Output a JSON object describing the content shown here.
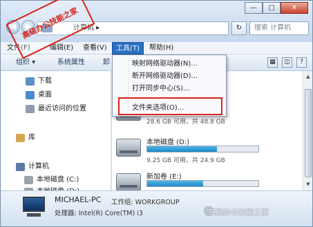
{
  "window": {
    "controls": {
      "minimize": "—",
      "maximize": "□",
      "close": "✕"
    }
  },
  "stamp": {
    "text": "高级办公技能之家"
  },
  "address": {
    "path": "计算机 ▸",
    "refresh": "↻",
    "search_placeholder": "搜索 计算机"
  },
  "menubar": {
    "items": [
      {
        "label": "文件(F)"
      },
      {
        "label": "编辑(E)"
      },
      {
        "label": "查看(V)"
      },
      {
        "label": "工具(T)"
      },
      {
        "label": "帮助(H)"
      }
    ]
  },
  "cmdbar": {
    "organize": "组织 ▾",
    "system_props": "系统属性",
    "cut_label": "卸"
  },
  "navpane": {
    "items": [
      {
        "label": "下载"
      },
      {
        "label": "桌面"
      },
      {
        "label": "最近访问的位置"
      },
      {
        "label": "库"
      },
      {
        "label": "计算机"
      },
      {
        "label": "本地磁盘 (C:)"
      },
      {
        "label": "本地磁盘 (D:)"
      }
    ]
  },
  "drives": [
    {
      "name": "",
      "free": "28.6 GB 可用，共 48.8 GB",
      "used_fraction": 0.41
    },
    {
      "name": "本地磁盘 (D:)",
      "free": "9.25 GB 可用，共 24.9 GB",
      "used_fraction": 0.63
    },
    {
      "name": "新加卷 (E:)",
      "free": "",
      "used_fraction": 0.5
    }
  ],
  "tools_menu": {
    "items": [
      {
        "label": "映射网络驱动器(N)..."
      },
      {
        "label": "断开网络驱动器(D)..."
      },
      {
        "label": "打开同步中心(S)..."
      },
      {
        "label": "文件夹选项(O)..."
      }
    ]
  },
  "details": {
    "pc_name": "MICHAEL-PC",
    "workgroup": "工作组: WORKGROUP",
    "processor": "处理器: Intel(R) Core(TM) i3",
    "watermark": "高级办公技能之家"
  },
  "colors": {
    "accent": "#2a6fc2",
    "highlight_border": "#d8221a",
    "bar_fill": "#1d86c6"
  }
}
